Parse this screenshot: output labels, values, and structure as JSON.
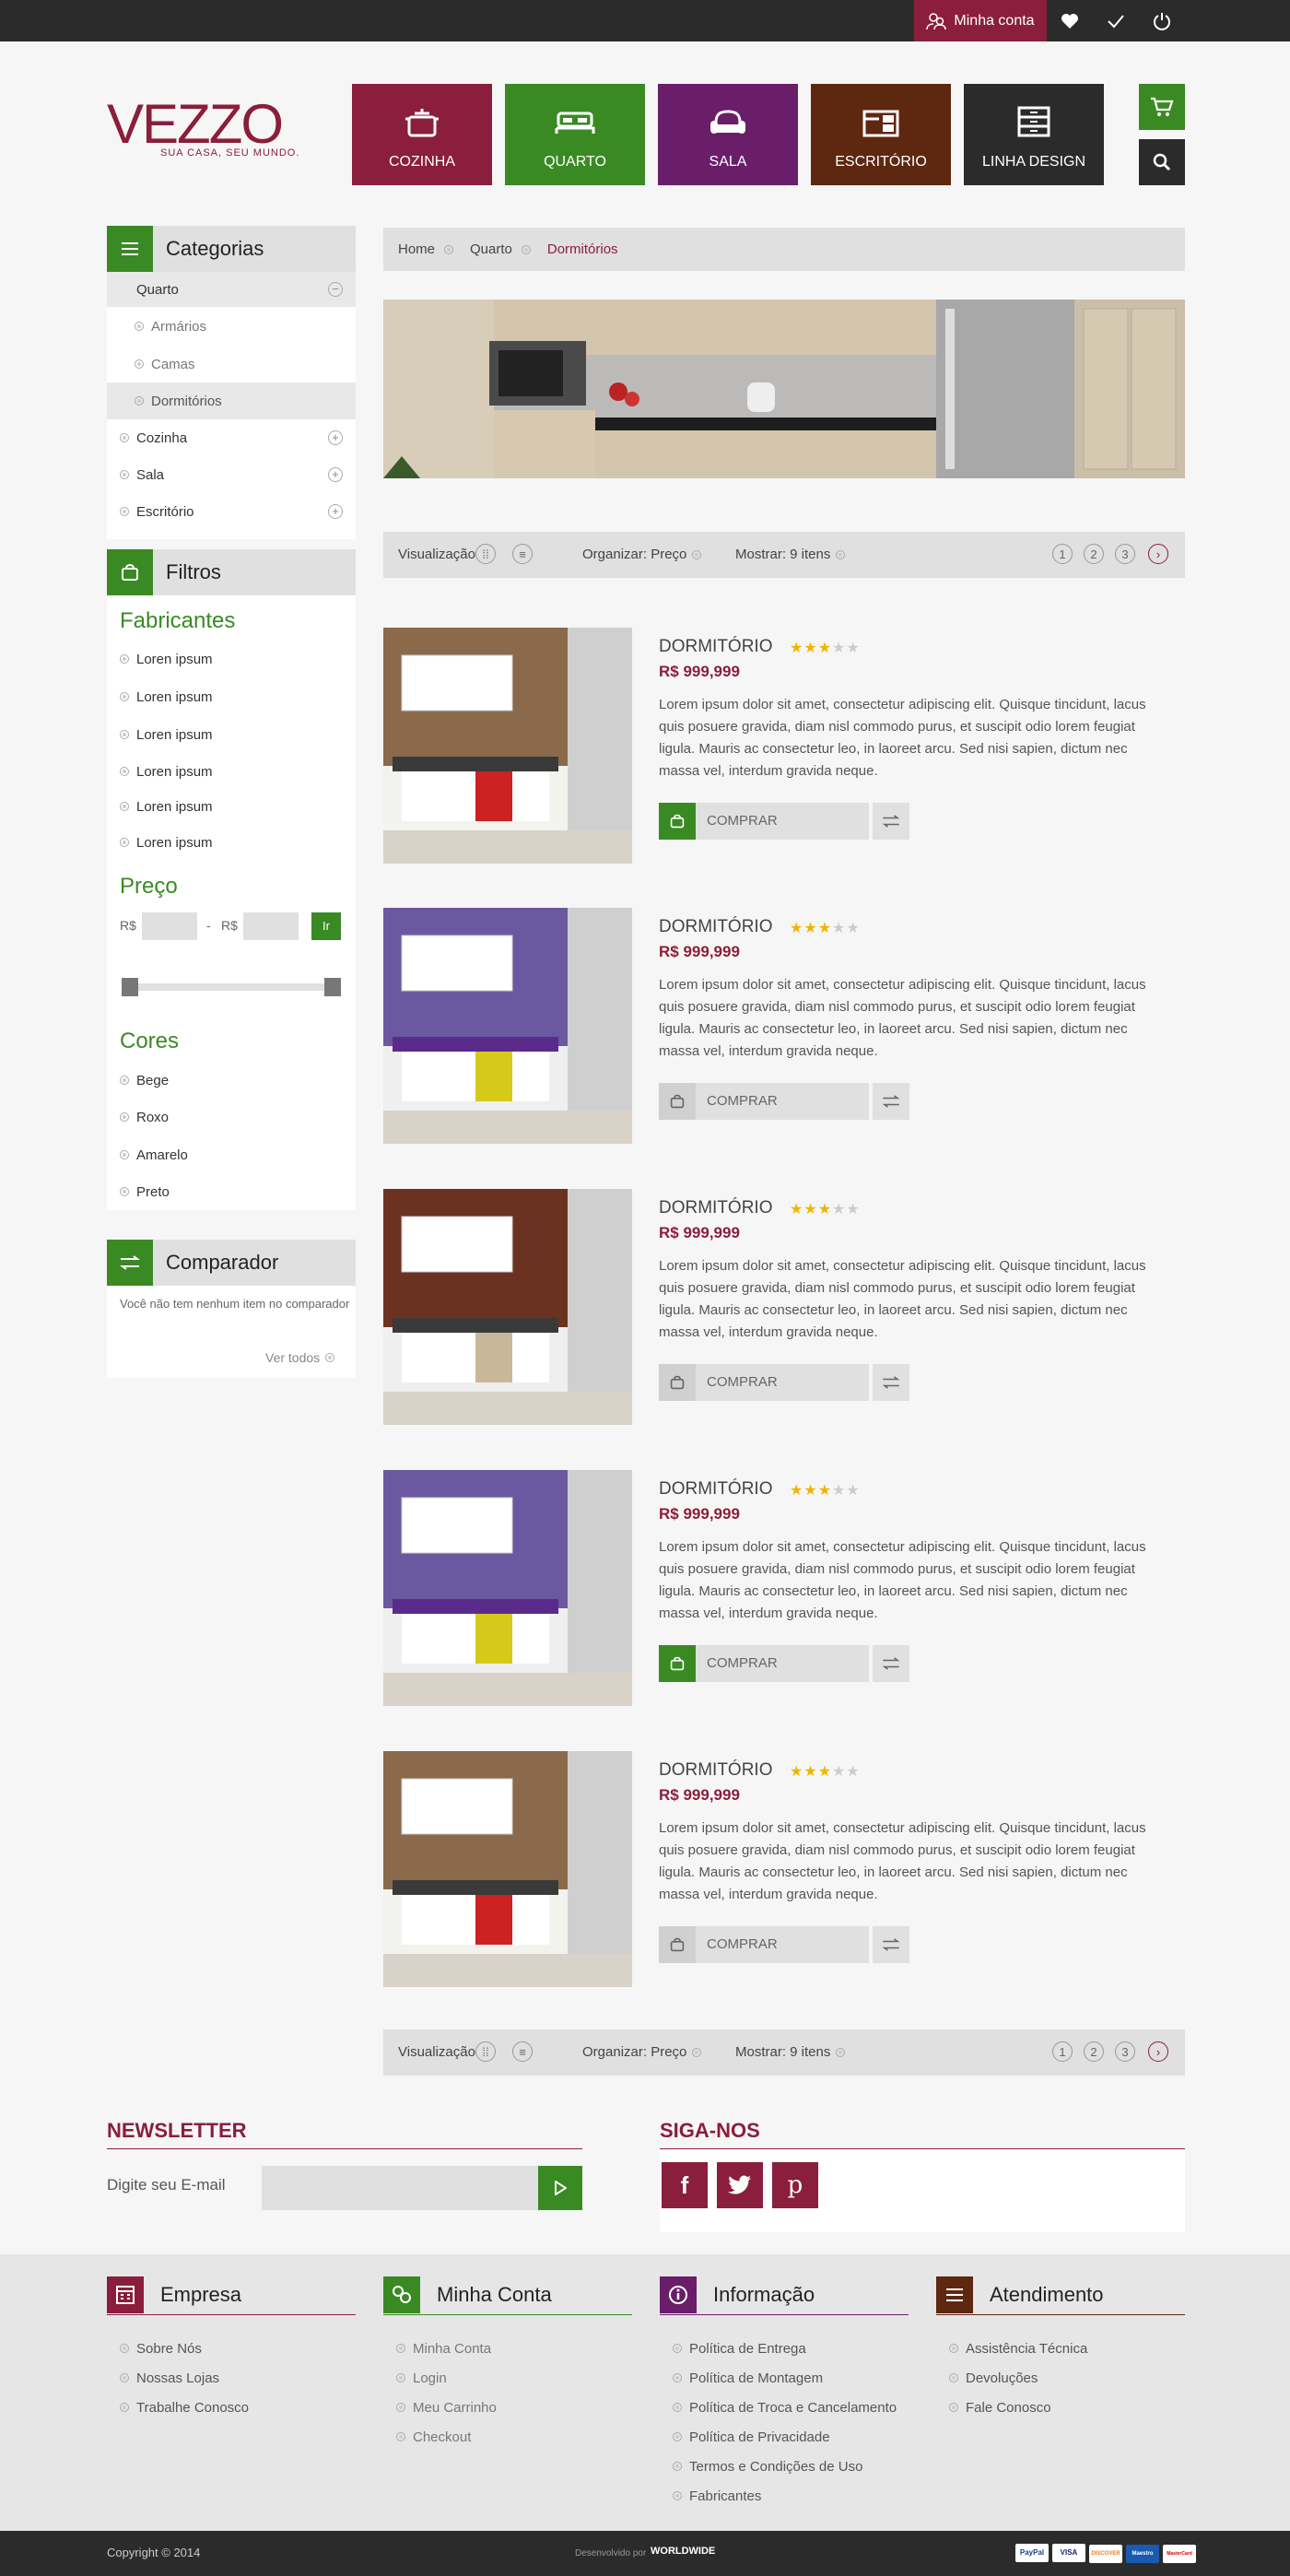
{
  "topbar": {
    "account_label": "Minha conta"
  },
  "brand": {
    "name": "VEZZO",
    "tagline": "SUA CASA, SEU MUNDO."
  },
  "categories": [
    {
      "label": "COZINHA",
      "icon": "pot-icon",
      "color": "#8a1e3c"
    },
    {
      "label": "QUARTO",
      "icon": "bed-icon",
      "color": "#3a8a24"
    },
    {
      "label": "SALA",
      "icon": "sofa-icon",
      "color": "#6a1e6a"
    },
    {
      "label": "ESCRITÓRIO",
      "icon": "desk-icon",
      "color": "#5e2710"
    },
    {
      "label": "LINHA DESIGN",
      "icon": "dresser-icon",
      "color": "#2b2b2b"
    }
  ],
  "sidebar": {
    "categories_title": "Categorias",
    "active": "Quarto",
    "sub": [
      "Armários",
      "Camas",
      "Dormitórios"
    ],
    "others": [
      "Cozinha",
      "Sala",
      "Escritório"
    ],
    "filters_title": "Filtros",
    "makers_title": "Fabricantes",
    "makers": [
      "Loren ipsum",
      "Loren ipsum",
      "Loren ipsum",
      "Loren ipsum",
      "Loren ipsum",
      "Loren ipsum"
    ],
    "price_title": "Preço",
    "currency": "R$",
    "price_sep": "-",
    "go": "Ir",
    "colors_title": "Cores",
    "colors": [
      "Bege",
      "Roxo",
      "Amarelo",
      "Preto"
    ],
    "compare_title": "Comparador",
    "compare_empty": "Você não tem nenhum item no comparador",
    "see_all": "Ver todos"
  },
  "breadcrumb": [
    "Home",
    "Quarto",
    "Dormitórios"
  ],
  "toolbar": {
    "view": "Visualização",
    "sort": "Organizar: Preço",
    "show": "Mostrar:  9 itens",
    "pages": [
      "1",
      "2",
      "3"
    ]
  },
  "products": [
    {
      "name": "DORMITÓRIO",
      "price": "R$ 999,999",
      "rating": 3,
      "active": true,
      "desc": "Lorem ipsum dolor sit amet, consectetur adipiscing elit. Quisque tincidunt, lacus quis posuere gravida, diam nisl commodo purus, et suscipit odio lorem feugiat ligula. Mauris ac consectetur leo, in laoreet arcu. Sed nisi sapien, dictum nec massa vel, interdum gravida neque.",
      "buy": "COMPRAR"
    },
    {
      "name": "DORMITÓRIO",
      "price": "R$ 999,999",
      "rating": 3,
      "active": false,
      "desc": "Lorem ipsum dolor sit amet, consectetur adipiscing elit. Quisque tincidunt, lacus quis posuere gravida, diam nisl commodo purus, et suscipit odio lorem feugiat ligula. Mauris ac consectetur leo, in laoreet arcu. Sed nisi sapien, dictum nec massa vel, interdum gravida neque.",
      "buy": "COMPRAR"
    },
    {
      "name": "DORMITÓRIO",
      "price": "R$ 999,999",
      "rating": 3,
      "active": false,
      "desc": "Lorem ipsum dolor sit amet, consectetur adipiscing elit. Quisque tincidunt, lacus quis posuere gravida, diam nisl commodo purus, et suscipit odio lorem feugiat ligula. Mauris ac consectetur leo, in laoreet arcu. Sed nisi sapien, dictum nec massa vel, interdum gravida neque.",
      "buy": "COMPRAR"
    },
    {
      "name": "DORMITÓRIO",
      "price": "R$ 999,999",
      "rating": 3,
      "active": true,
      "desc": "Lorem ipsum dolor sit amet, consectetur adipiscing elit. Quisque tincidunt, lacus quis posuere gravida, diam nisl commodo purus, et suscipit odio lorem feugiat ligula. Mauris ac consectetur leo, in laoreet arcu. Sed nisi sapien, dictum nec massa vel, interdum gravida neque.",
      "buy": "COMPRAR"
    },
    {
      "name": "DORMITÓRIO",
      "price": "R$ 999,999",
      "rating": 3,
      "active": false,
      "desc": "Lorem ipsum dolor sit amet, consectetur adipiscing elit. Quisque tincidunt, lacus quis posuere gravida, diam nisl commodo purus, et suscipit odio lorem feugiat ligula. Mauris ac consectetur leo, in laoreet arcu. Sed nisi sapien, dictum nec massa vel, interdum gravida neque.",
      "buy": "COMPRAR"
    }
  ],
  "newsletter": {
    "title": "NEWSLETTER",
    "label": "Digite seu E-mail"
  },
  "social": {
    "title": "SIGA-NOS",
    "networks": [
      "facebook-icon",
      "twitter-icon",
      "pinterest-icon"
    ]
  },
  "footer": {
    "cols": [
      {
        "title": "Empresa",
        "icon": "building-icon",
        "color": "#8a1e3c",
        "links": [
          "Sobre Nós",
          "Nossas Lojas",
          "Trabalhe Conosco"
        ]
      },
      {
        "title": "Minha Conta",
        "icon": "users-icon",
        "color": "#3a8a24",
        "links": [
          "Minha Conta",
          "Login",
          "Meu Carrinho",
          "Checkout"
        ]
      },
      {
        "title": "Informação",
        "icon": "info-icon",
        "color": "#6a1e6a",
        "links": [
          "Política de Entrega",
          "Política de Montagem",
          "Política de Troca e Cancelamento",
          "Política de Privacidade",
          "Termos e Condições de Uso",
          "Fabricantes"
        ]
      },
      {
        "title": "Atendimento",
        "icon": "menu-icon",
        "color": "#5e2710",
        "links": [
          "Assistência Técnica",
          "Devoluções",
          "Fale Conosco"
        ]
      }
    ],
    "copyright": "Copyright © 2014",
    "dev": "Desenvolvido por",
    "dev_brand": "WORLDWIDE",
    "payments": [
      "PayPal",
      "VISA",
      "DISCOVER",
      "Maestro",
      "MasterCard"
    ]
  },
  "colors": {
    "wine": "#8a1e3c",
    "green": "#3a8a24",
    "purple": "#6a1e6a",
    "brown": "#5e2710",
    "dark": "#2b2b2b",
    "star": "#f0b400"
  }
}
